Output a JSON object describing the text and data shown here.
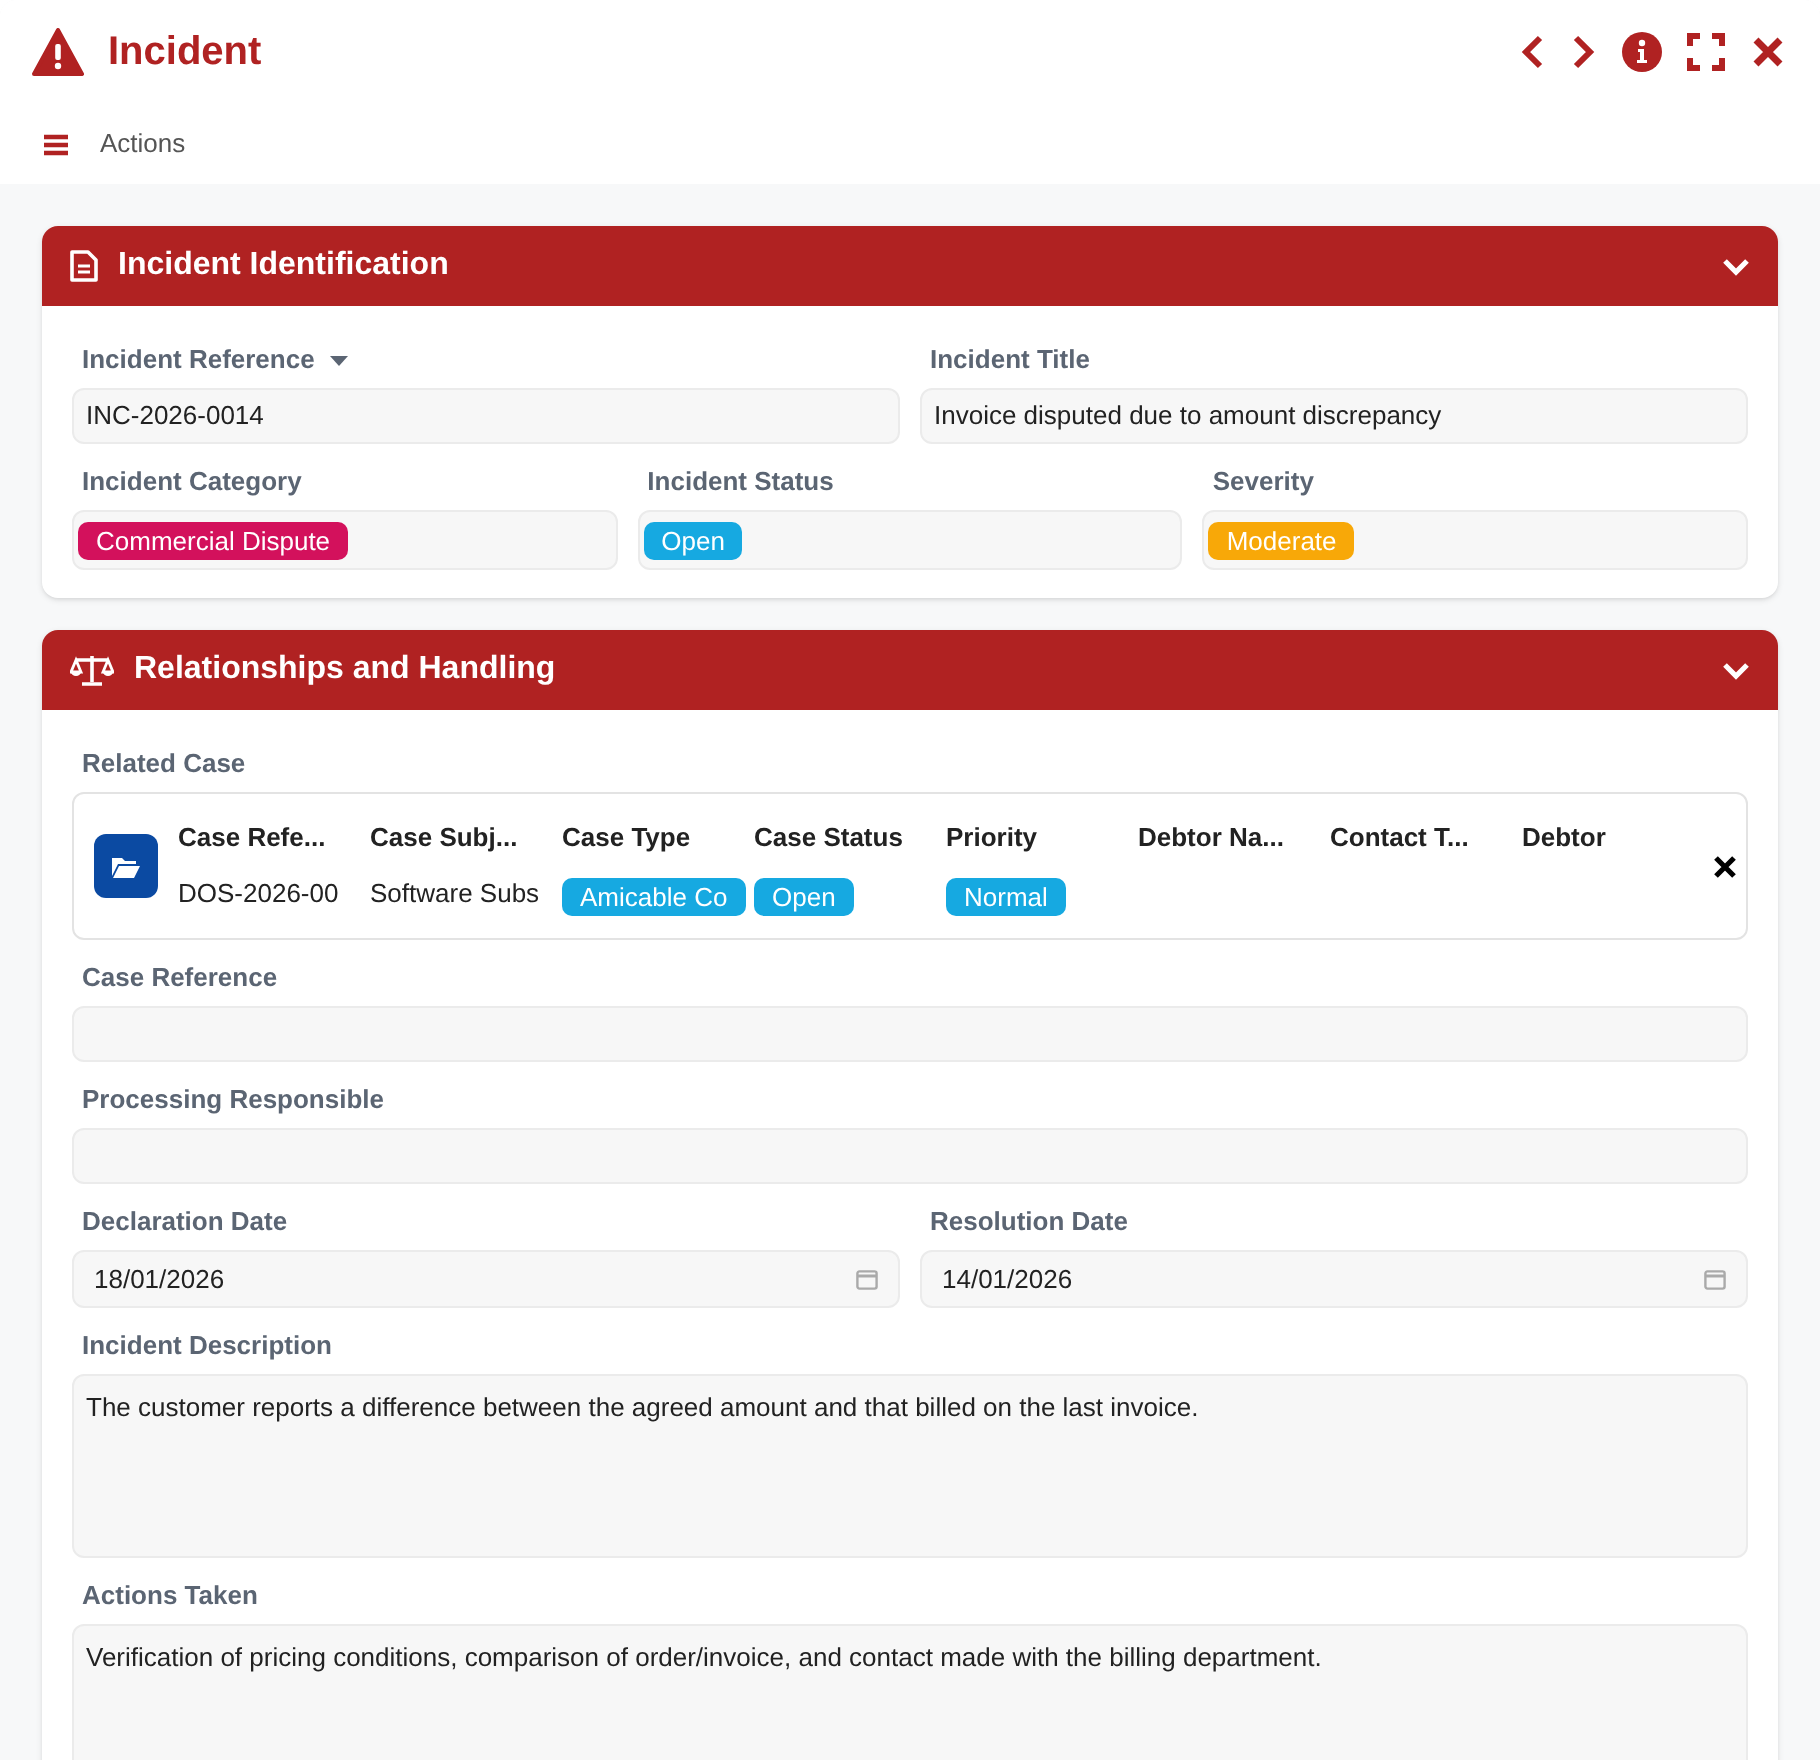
{
  "window": {
    "title": "Incident"
  },
  "toolbar": {
    "label": "Actions"
  },
  "sections": [
    {
      "title": "Incident Identification",
      "lines": [
        {
          "fields": [
            {
              "kind": "text",
              "label": "Incident Reference",
              "label_menu": true,
              "value": "INC-2026-0014"
            },
            {
              "kind": "text",
              "label": "Incident Title",
              "value": "Invoice disputed due to amount discrepancy"
            }
          ]
        },
        {
          "fields": [
            {
              "kind": "tag",
              "label": "Incident Category",
              "value": "Commercial Dispute",
              "color": "#d3115c"
            },
            {
              "kind": "tag",
              "label": "Incident Status",
              "value": "Open",
              "color": "#16a9e1"
            },
            {
              "kind": "tag",
              "label": "Severity",
              "value": "Moderate",
              "color": "#f8a808"
            }
          ]
        }
      ]
    },
    {
      "title": "Relationships and Handling",
      "lines": [
        {
          "fields": [
            {
              "kind": "relation",
              "label": "Related Case",
              "columns": [
                {
                  "header": "Case Refe...",
                  "value": "DOS-2026-00"
                },
                {
                  "header": "Case Subj...",
                  "value": "Software Subs"
                },
                {
                  "header": "Case Type",
                  "value": "Amicable Co",
                  "color": "#16a9e1"
                },
                {
                  "header": "Case Status",
                  "value": "Open",
                  "color": "#16a9e1"
                },
                {
                  "header": "Priority",
                  "value": "Normal",
                  "color": "#16a9e1"
                },
                {
                  "header": "Debtor Na..."
                },
                {
                  "header": "Contact T..."
                },
                {
                  "header": "Debtor"
                }
              ]
            }
          ]
        },
        {
          "fields": [
            {
              "kind": "text",
              "label": "Case Reference"
            }
          ]
        },
        {
          "fields": [
            {
              "kind": "text",
              "label": "Processing Responsible"
            }
          ]
        },
        {
          "fields": [
            {
              "kind": "date",
              "label": "Declaration Date",
              "value": "18/01/2026"
            },
            {
              "kind": "date",
              "label": "Resolution Date",
              "value": "14/01/2026"
            }
          ]
        },
        {
          "fields": [
            {
              "kind": "textarea",
              "label": "Incident Description",
              "value": "The customer reports a difference between the agreed amount and that billed on the last invoice."
            }
          ]
        },
        {
          "fields": [
            {
              "kind": "textarea",
              "label": "Actions Taken",
              "value": "Verification of pricing conditions, comparison of order/invoice, and contact made with the billing department."
            }
          ]
        }
      ]
    }
  ]
}
